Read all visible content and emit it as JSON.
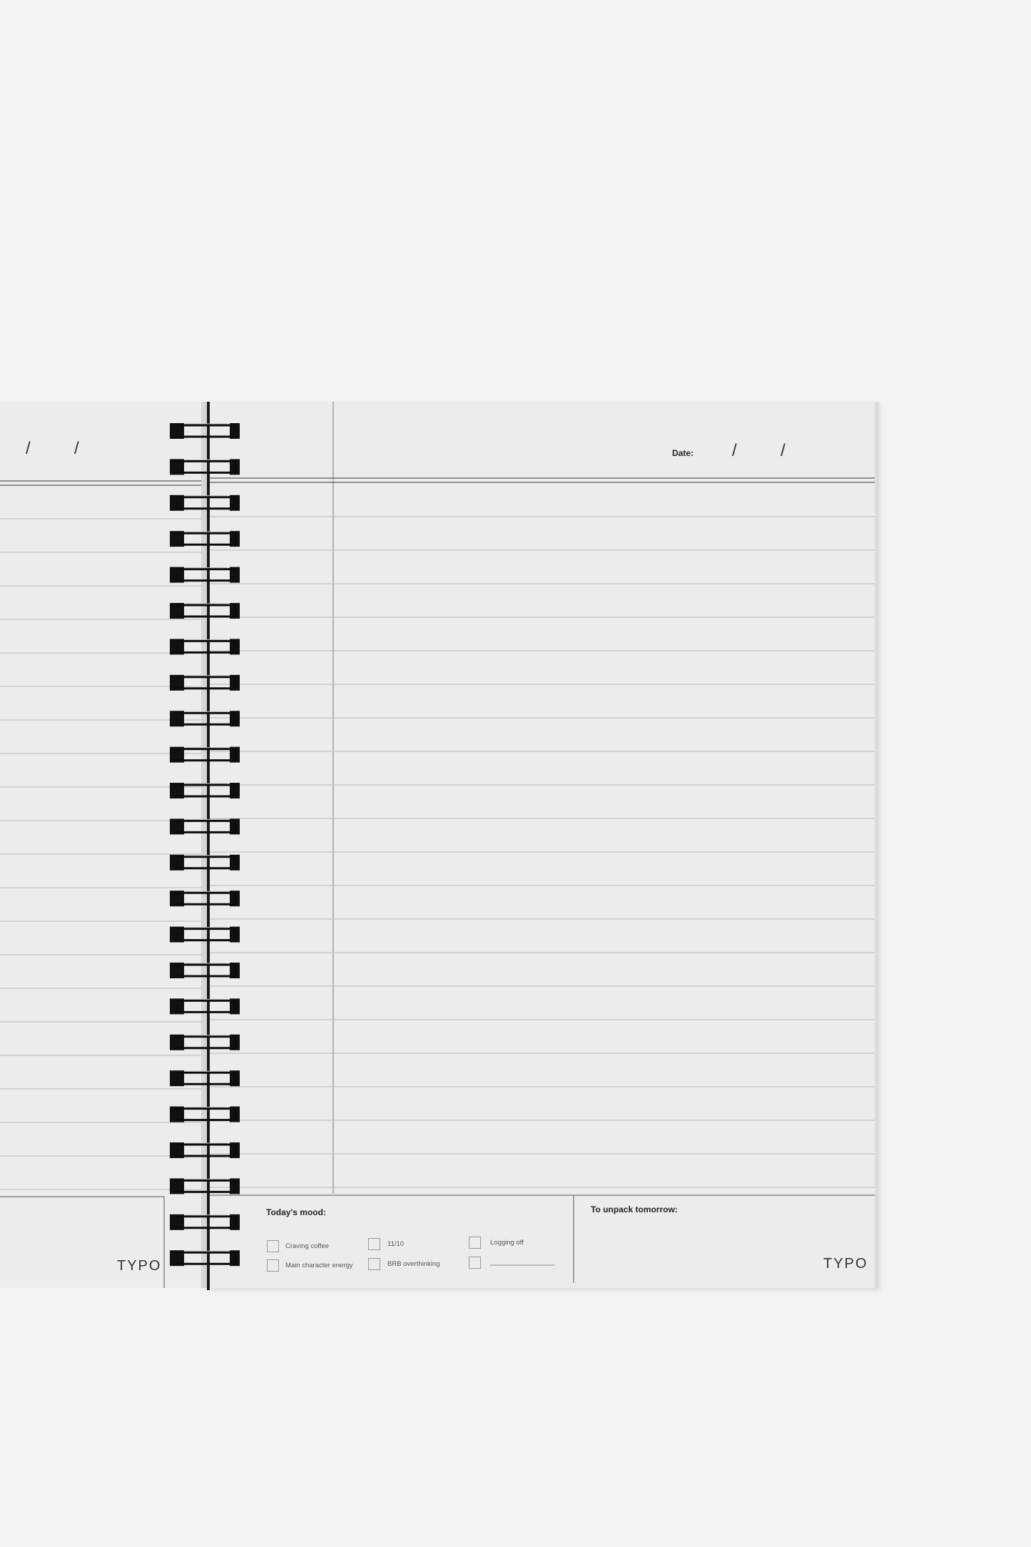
{
  "page": {
    "date_label": "Date:",
    "slash": "/",
    "mood_title": "Today's mood:",
    "mood_options": [
      "Craving coffee",
      "11/10",
      "Logging off",
      "Main character energy",
      "BRB overthinking",
      ""
    ],
    "unpack_title": "To unpack tomorrow:",
    "brand": "TYPO"
  },
  "colors": {
    "background": "#f3f3f3",
    "paper": "#ececed",
    "ring": "#111111",
    "rule": "#b9b9b9"
  }
}
